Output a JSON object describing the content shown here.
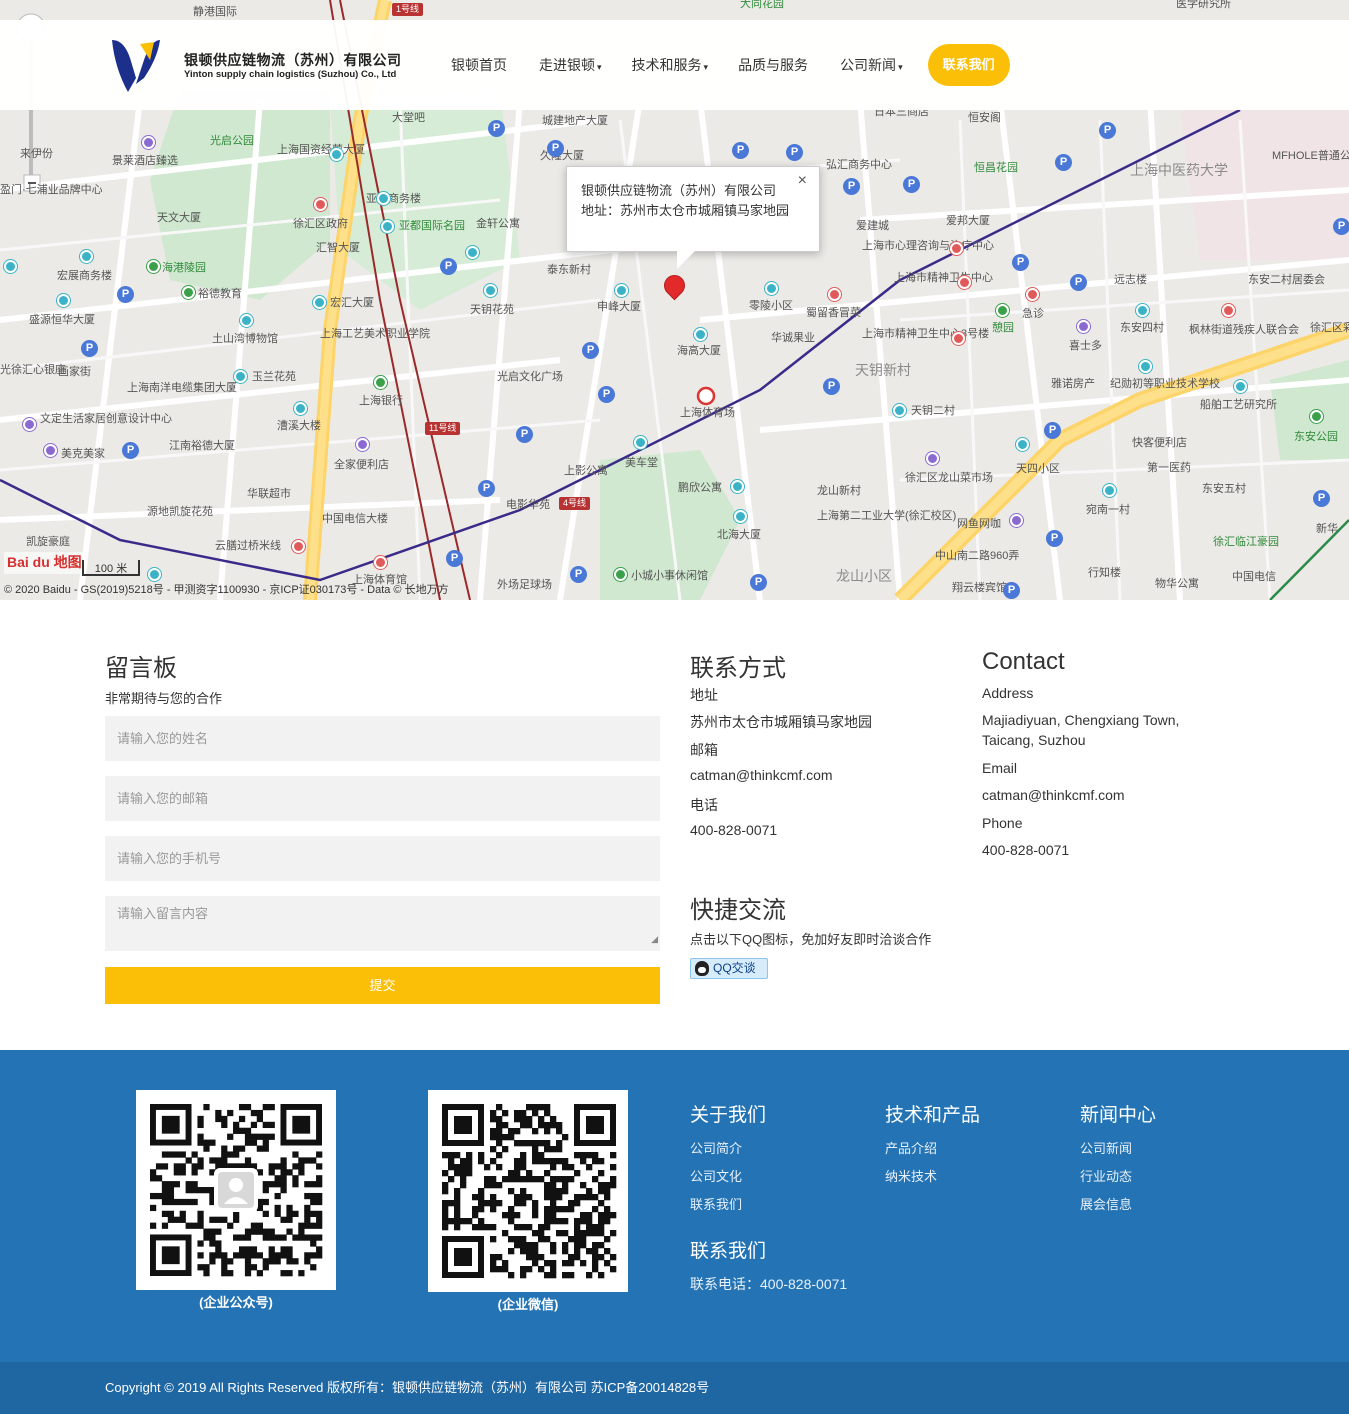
{
  "header": {
    "company_cn": "银顿供应链物流（苏州）有限公司",
    "company_en": "Yinton supply chain logistics (Suzhou) Co., Ltd",
    "nav": [
      {
        "label": "银顿首页",
        "caret": ""
      },
      {
        "label": "走进银顿",
        "caret": "▾"
      },
      {
        "label": "技术和服务",
        "caret": "▾"
      },
      {
        "label": "品质与服务",
        "caret": ""
      },
      {
        "label": "公司新闻",
        "caret": "▾"
      }
    ],
    "cta_label": "联系我们",
    "brand_colors": {
      "primary": "#fbbf08",
      "navy": "#1c2f8a",
      "footer": "#2474b5"
    }
  },
  "map": {
    "popup_line1": "银顿供应链物流（苏州）有限公司",
    "popup_line2": "地址：苏州市太仓市城厢镇马家地园",
    "close": "×",
    "copyright": "© 2020 Baidu - GS(2019)5218号 - 甲测资字1100930 - 京ICP证030173号 - Data © 长地万方",
    "baidu_logo": "Bai du 地图",
    "scale": "100 米",
    "labels": [
      {
        "t": "静港国际"
      },
      {
        "t": "1号线",
        "tag": "metro"
      },
      {
        "t": "医学研究所"
      },
      {
        "t": "大同花园"
      },
      {
        "t": "光启公园"
      },
      {
        "t": "上海国资经营大厦"
      },
      {
        "t": "大堂吧"
      },
      {
        "t": "城建地产大厦"
      },
      {
        "t": "日本三商店"
      },
      {
        "t": "恒安阁"
      },
      {
        "t": "久隆大厦"
      },
      {
        "t": "弘汇商务中心"
      },
      {
        "t": "恒昌花园"
      },
      {
        "t": "上海中医药大学"
      },
      {
        "t": "MFHOLE普通公"
      },
      {
        "t": "景莱酒店臻选"
      },
      {
        "t": "来伊份"
      },
      {
        "t": "盈门·七浦业品牌中心"
      },
      {
        "t": "天文大厦"
      },
      {
        "t": "亚都商务楼"
      },
      {
        "t": "徐汇区政府"
      },
      {
        "t": "亚都国际名园"
      },
      {
        "t": "金轩公寓"
      },
      {
        "t": "爱建城"
      },
      {
        "t": "爱邦大厦"
      },
      {
        "t": "汇智大厦"
      },
      {
        "t": "上海市心理咨询与治疗中心"
      },
      {
        "t": "宏展商务楼"
      },
      {
        "t": "海港陵园"
      },
      {
        "t": "泰东新村"
      },
      {
        "t": "上海市精神卫生中心"
      },
      {
        "t": "远志楼"
      },
      {
        "t": "东安二村居委会"
      },
      {
        "t": "裕德教育"
      },
      {
        "t": "天钥花苑"
      },
      {
        "t": "申峰大厦"
      },
      {
        "t": "零陵小区"
      },
      {
        "t": "蜀留香冒菜"
      },
      {
        "t": "盛源恒华大厦"
      },
      {
        "t": "宏汇大厦"
      },
      {
        "t": "土山湾博物馆"
      },
      {
        "t": "上海工艺美术职业学院"
      },
      {
        "t": "华诚果业"
      },
      {
        "t": "上海市精神卫生中心3号楼"
      },
      {
        "t": "东安四村"
      },
      {
        "t": "枫林街道残疾人联合会"
      },
      {
        "t": "徐汇区彩虹进修学"
      },
      {
        "t": "海高大厦"
      },
      {
        "t": "喜士多"
      },
      {
        "t": "光徐汇心银座"
      },
      {
        "t": "画家街"
      },
      {
        "t": "玉兰花苑"
      },
      {
        "t": "光启文化广场"
      },
      {
        "t": "上海体育场"
      },
      {
        "t": "天钥新村"
      },
      {
        "t": "雅诺房产"
      },
      {
        "t": "纪勋初等职业技术学校"
      },
      {
        "t": "船舶工艺研究所"
      },
      {
        "t": "上海南洋电缆集团大厦"
      },
      {
        "t": "上海银行"
      },
      {
        "t": "天钥二村"
      },
      {
        "t": "文定生活家居创意设计中心"
      },
      {
        "t": "漕溪大楼"
      },
      {
        "t": "11号线",
        "tag": "metro"
      },
      {
        "t": "快客便利店"
      },
      {
        "t": "东安公园"
      },
      {
        "t": "江南裕德大厦"
      },
      {
        "t": "美克美家"
      },
      {
        "t": "全家便利店"
      },
      {
        "t": "上影公寓"
      },
      {
        "t": "美车堂"
      },
      {
        "t": "天四小区"
      },
      {
        "t": "徐汇区龙山菜市场"
      },
      {
        "t": "第一医药"
      },
      {
        "t": "华联超市"
      },
      {
        "t": "鹏欣公寓"
      },
      {
        "t": "龙山新村"
      },
      {
        "t": "东安五村"
      },
      {
        "t": "源地凯旋花苑"
      },
      {
        "t": "电影华苑"
      },
      {
        "t": "4号线",
        "tag": "metro"
      },
      {
        "t": "宛南一村"
      },
      {
        "t": "凯旋豪庭"
      },
      {
        "t": "中国电信大楼"
      },
      {
        "t": "北海大厦"
      },
      {
        "t": "上海第二工业大学(徐汇校区)"
      },
      {
        "t": "网鱼网咖"
      },
      {
        "t": "新华"
      },
      {
        "t": "徐汇临江豪园"
      },
      {
        "t": "云膳过桥米线"
      },
      {
        "t": "中山南二路960弄"
      },
      {
        "t": "行知楼"
      },
      {
        "t": "物华公寓"
      },
      {
        "t": "中国电信"
      },
      {
        "t": "上海体育馆"
      },
      {
        "t": "外场足球场"
      },
      {
        "t": "小城小事休闲馆"
      },
      {
        "t": "龙山小区"
      },
      {
        "t": "翔云楼宾馆"
      },
      {
        "t": "急诊"
      },
      {
        "t": "憩园"
      }
    ]
  },
  "guestbook": {
    "title": "留言板",
    "subtitle": "非常期待与您的合作",
    "name_placeholder": "请输入您的姓名",
    "email_placeholder": "请输入您的邮箱",
    "phone_placeholder": "请输入您的手机号",
    "message_placeholder": "请输入留言内容",
    "submit_label": "提交"
  },
  "contact_cn": {
    "title": "联系方式",
    "address_label": "地址",
    "address": "苏州市太仓市城厢镇马家地园",
    "email_label": "邮箱",
    "email": "catman@thinkcmf.com",
    "phone_label": "电话",
    "phone": "400-828-0071"
  },
  "contact_en": {
    "title": "Contact",
    "address_label": "Address",
    "address_line1": "Majiadiyuan, Chengxiang Town,",
    "address_line2": "Taicang, Suzhou",
    "email_label": "Email",
    "email": "catman@thinkcmf.com",
    "phone_label": "Phone",
    "phone": "400-828-0071"
  },
  "quick_chat": {
    "title": "快捷交流",
    "subtitle": "点击以下QQ图标，免加好友即时洽谈合作",
    "qq_label": "QQ交谈"
  },
  "footer": {
    "qr1_caption": "(企业公众号)",
    "qr2_caption": "(企业微信)",
    "about": {
      "title": "关于我们",
      "links": [
        "公司简介",
        "公司文化",
        "联系我们"
      ]
    },
    "tech": {
      "title": "技术和产品",
      "links": [
        "产品介绍",
        "纳米技术"
      ]
    },
    "news": {
      "title": "新闻中心",
      "links": [
        "公司新闻",
        "行业动态",
        "展会信息"
      ]
    },
    "contact": {
      "title": "联系我们",
      "phone": "联系电话：400-828-0071"
    }
  },
  "copyright": "Copyright © 2019 All Rights Reserved 版权所有：银顿供应链物流（苏州）有限公司 苏ICP备20014828号"
}
